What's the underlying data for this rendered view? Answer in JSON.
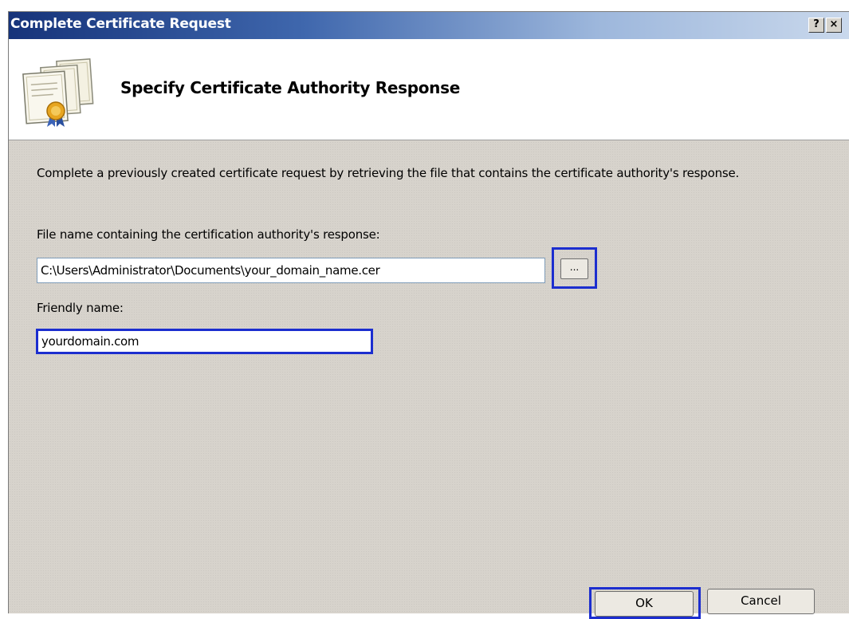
{
  "window": {
    "title": "Complete Certificate Request",
    "help_glyph": "?",
    "close_glyph": "×"
  },
  "header": {
    "title": "Specify Certificate Authority Response",
    "icon": "certificate-stack-icon"
  },
  "content": {
    "description": "Complete a previously created certificate request by retrieving the file that contains the certificate authority's response.",
    "file_label": "File name containing the certification authority's response:",
    "file_value": "C:\\Users\\Administrator\\Documents\\your_domain_name.cer",
    "browse_label": "...",
    "friendly_label": "Friendly name:",
    "friendly_value": "yourdomain.com"
  },
  "buttons": {
    "ok_label": "OK",
    "cancel_label": "Cancel"
  },
  "colors": {
    "highlight": "#1c2ecf",
    "title_bar_start": "#16337a",
    "dialog_bg": "#d7d3cc"
  }
}
